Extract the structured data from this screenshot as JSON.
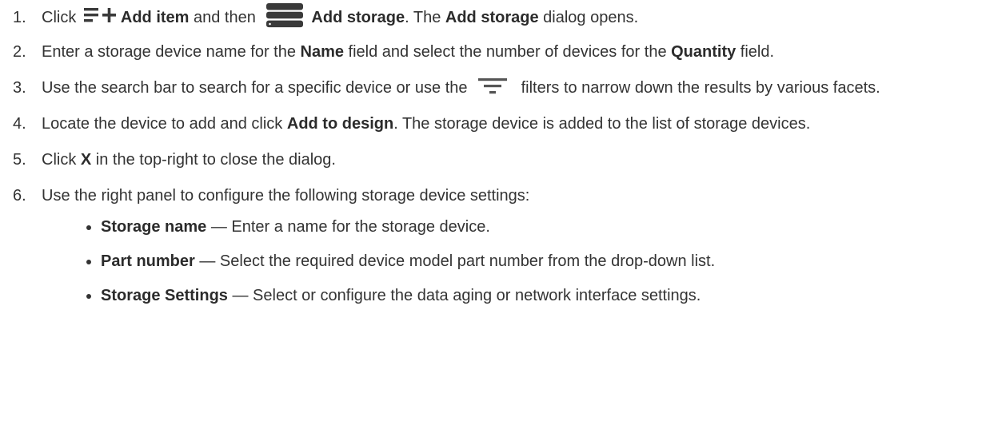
{
  "steps": [
    {
      "num": "1.",
      "t1": "Click ",
      "add_item_label": "Add item",
      "t2": " and then ",
      "add_storage_label": "Add storage",
      "t3": ". The ",
      "dialog_name": "Add storage",
      "t4": " dialog opens.",
      "icons": [
        "add-item-icon",
        "storage-icon"
      ]
    },
    {
      "num": "2.",
      "t1": "Enter a storage device name for the ",
      "name_field": "Name",
      "t2": " field and select the number of devices for the ",
      "quantity_field": "Quantity",
      "t3": " field."
    },
    {
      "num": "3.",
      "t1": "Use the search bar to search for a specific device or use the ",
      "t2": " filters to narrow down the results by various facets.",
      "icons": [
        "filter-icon"
      ]
    },
    {
      "num": "4.",
      "t1": "Locate the device to add and click ",
      "add_to_design": "Add to design",
      "t2": ". The storage device is added to the list of storage devices."
    },
    {
      "num": "5.",
      "t1": "Click ",
      "x_label": "X",
      "t2": " in the top-right to close the dialog."
    },
    {
      "num": "6.",
      "t1": "Use the right panel to configure the following storage device settings:"
    }
  ],
  "settings": [
    {
      "term": "Storage name",
      "desc": " — Enter a name for the storage device."
    },
    {
      "term": "Part number",
      "desc": " — Select the required device model part number from the drop-down list."
    },
    {
      "term": "Storage Settings",
      "desc": " — Select or configure the data aging or network interface settings."
    }
  ],
  "colors": {
    "text": "#333333",
    "icon": "#3a3a3a",
    "icon_light": "#666666"
  }
}
